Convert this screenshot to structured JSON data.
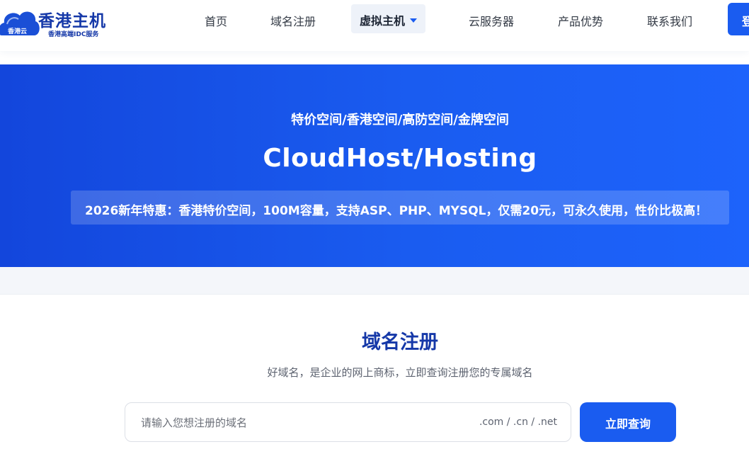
{
  "header": {
    "logo": {
      "title": "香港主机",
      "subtitle": "香港高端IDC服务",
      "badge": "香港云"
    },
    "nav": [
      {
        "label": "首页"
      },
      {
        "label": "域名注册"
      },
      {
        "label": "虚拟主机",
        "active": true,
        "has_dropdown": true
      },
      {
        "label": "云服务器"
      },
      {
        "label": "产品优势"
      },
      {
        "label": "联系我们"
      }
    ],
    "login_label": "登录"
  },
  "hero": {
    "subtitle": "特价空间/香港空间/高防空间/金牌空间",
    "title": "CloudHost/Hosting",
    "promo": "2026新年特惠：香港特价空间，100M容量，支持ASP、PHP、MYSQL，仅需20元，可永久使用，性价比极高！"
  },
  "domain": {
    "title": "域名注册",
    "description": "好域名，是企业的网上商标，立即查询注册您的专属域名",
    "search": {
      "placeholder": "请输入您想注册的域名",
      "suffixes": ".com / .cn / .net",
      "button_label": "立即查询"
    }
  },
  "colors": {
    "brand": "#1a5cf0",
    "logo_text": "#1538a8",
    "hero_start": "#1346dc",
    "hero_end": "#1d63fb"
  },
  "icons": {
    "logo": "cloud-icon",
    "dropdown": "caret-down-icon"
  }
}
